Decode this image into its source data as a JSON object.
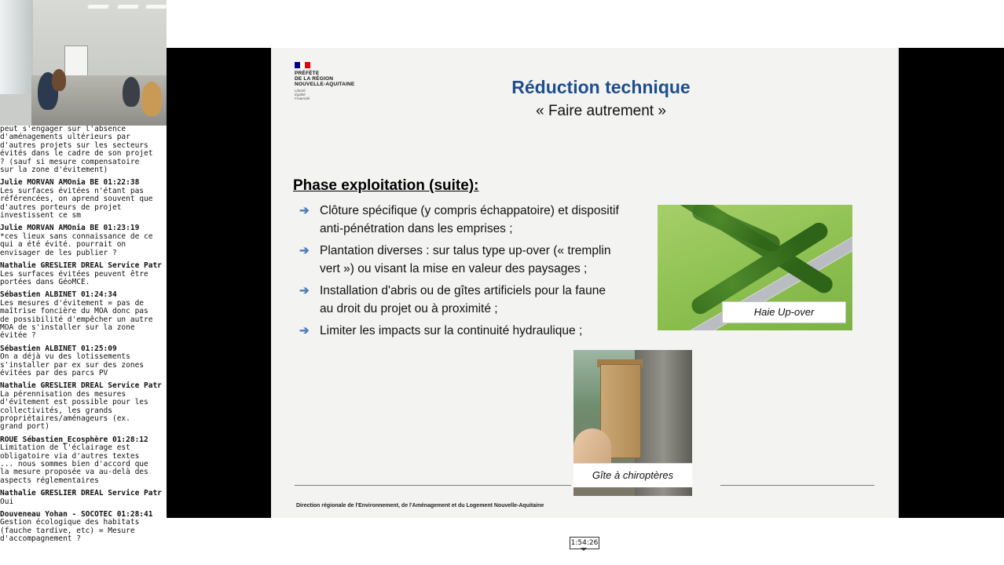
{
  "slide": {
    "logo": {
      "lines": [
        "PRÉFÈTE",
        "DE LA RÉGION",
        "NOUVELLE-AQUITAINE"
      ],
      "motto": [
        "Liberté",
        "Égalité",
        "Fraternité"
      ],
      "flag_colors": [
        "#000091",
        "#ffffff",
        "#e1000f"
      ]
    },
    "title": "Réduction technique",
    "subtitle": "« Faire autrement »",
    "section_heading": "Phase exploitation (suite):",
    "bullets": [
      "Clôture spécifique (y compris échappatoire) et dispositif anti-pénétration dans les emprises ;",
      "Plantation diverses : sur talus type up-over (« tremplin vert ») ou visant la mise en valeur des paysages ;",
      "Installation d'abris ou de gîtes artificiels pour la faune au droit du projet ou à proximité ;",
      "Limiter les impacts sur la continuité hydraulique ;"
    ],
    "images": {
      "hedge_caption": "Haie Up-over",
      "bat_caption": "Gîte à chiroptères"
    },
    "footer": "Direction régionale de l'Environnement, de l'Aménagement et du Logement Nouvelle-Aquitaine",
    "title_color": "#1f4e8c",
    "bullet_arrow_color": "#4a7ebb"
  },
  "chat": {
    "continuation": "peut s'engager sur l'absence\nd'aménagements ultérieurs par\nd'autres projets sur les secteurs\névités dans le cadre de son projet\n? (sauf si mesure compensatoire\nsur la zone d'évitement)",
    "messages": [
      {
        "header": "Julie MORVAN AMOnia BE 01:22:38",
        "text": "Les surfaces évitées n'étant pas\nréférencées, on aprend souvent que\nd'autres porteurs de projet\ninvestissent ce sm"
      },
      {
        "header": "Julie MORVAN AMOnia BE 01:23:19",
        "text": "*ces lieux sans connaissance de ce\nqui a été évité. pourrait on\nenvisager de les publier ?"
      },
      {
        "header": "Nathalie GRESLIER DREAL Service Patr",
        "text": "Les surfaces évitées peuvent être\nportées dans GéoMCE."
      },
      {
        "header": "Sébastien ALBINET 01:24:34",
        "text": "Les mesures d'évitement = pas de\nmaîtrise foncière du MOA donc pas\nde possibilité d'empêcher un autre\nMOA de s'installer sur la zone\névitée ?"
      },
      {
        "header": "Sébastien ALBINET 01:25:09",
        "text": "On a déjà vu des lotissements\ns'installer par ex sur des zones\névitées par des parcs PV"
      },
      {
        "header": "Nathalie GRESLIER DREAL Service Patr",
        "text": "La pérennisation des mesures\nd'évitement est possible pour les\ncollectivités, les grands\npropriétaires/aménageurs (ex.\ngrand port)"
      },
      {
        "header": "ROUE Sébastien_Ecosphère 01:28:12",
        "text": "Limitation de l'éclairage est\nobligatoire via d'autres textes\n... nous sommes bien d'accord que\nla mesure proposée va au-delà des\naspects réglementaires"
      },
      {
        "header": "Nathalie GRESLIER DREAL Service Patr",
        "text": "Oui"
      },
      {
        "header": "Douveneau Yohan - SOCOTEC 01:28:41",
        "text": "Gestion écologique des habitats\n(fauche tardive, etc) = Mesure\nd'accompagnement ?"
      }
    ]
  },
  "player": {
    "timestamp": "1:54:26"
  }
}
